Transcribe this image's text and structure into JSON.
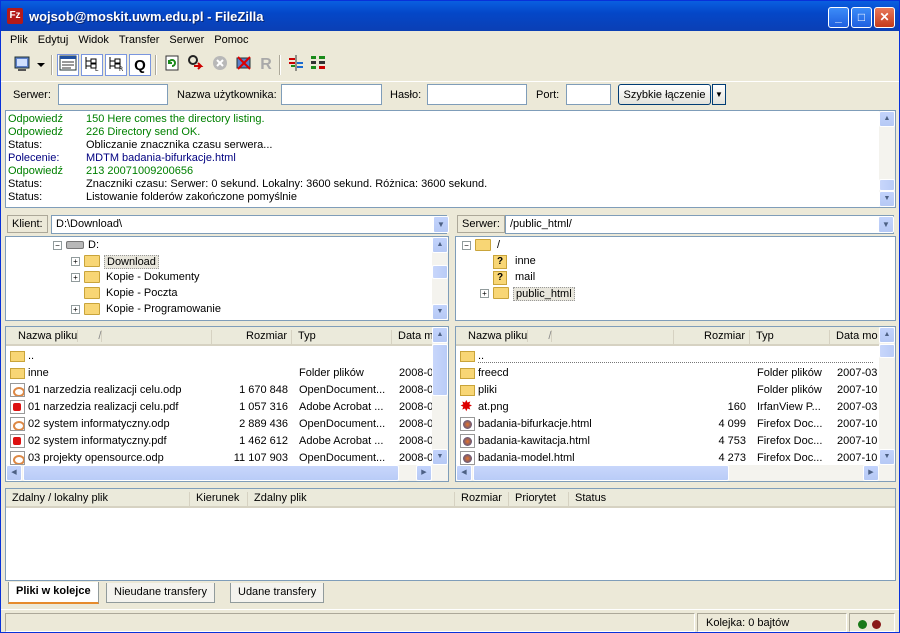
{
  "window": {
    "title": "wojsob@moskit.uwm.edu.pl - FileZilla",
    "app_icon": "Fz",
    "controls": {
      "minimize": "_",
      "maximize": "□",
      "close": "✕"
    }
  },
  "menu": [
    "Plik",
    "Edytuj",
    "Widok",
    "Transfer",
    "Serwer",
    "Pomoc"
  ],
  "toolbar": {
    "icons": [
      "site-manager-icon",
      "toggle-log-icon",
      "toggle-local-tree-icon",
      "toggle-remote-tree-icon",
      "toggle-queue-icon",
      "refresh-icon",
      "process-queue-icon",
      "cancel-icon",
      "disconnect-icon",
      "reconnect-icon",
      "compare-icon",
      "sync-browse-icon"
    ],
    "reconnect_glyph": "R",
    "queue_glyph": "Q"
  },
  "quickconnect": {
    "server_label": "Serwer:",
    "server_value": "",
    "user_label": "Nazwa użytkownika:",
    "user_value": "",
    "password_label": "Hasło:",
    "password_value": "",
    "port_label": "Port:",
    "port_value": "",
    "connect_button": "Szybkie łączenie",
    "dropdown_glyph": "▼"
  },
  "log": [
    {
      "type": "Odpowiedź",
      "msg": "150 Here comes the directory listing.",
      "color": "#008000"
    },
    {
      "type": "Odpowiedź",
      "msg": "226 Directory send OK.",
      "color": "#008000"
    },
    {
      "type": "Status:",
      "msg": "Obliczanie znacznika czasu serwera...",
      "color": "#000000"
    },
    {
      "type": "Polecenie:",
      "msg": "MDTM badania-bifurkacje.html",
      "color": "#000080"
    },
    {
      "type": "Odpowiedź",
      "msg": "213 20071009200656",
      "color": "#008000"
    },
    {
      "type": "Status:",
      "msg": "Znaczniki czasu: Serwer: 0 sekund. Lokalny: 3600 sekund. Różnica: 3600 sekund.",
      "color": "#000000"
    },
    {
      "type": "Status:",
      "msg": "Listowanie folderów zakończone pomyślnie",
      "color": "#000000"
    }
  ],
  "local": {
    "label": "Klient:",
    "path": "D:\\Download\\",
    "tree": [
      {
        "label": "D:",
        "kind": "drive",
        "expander": "−",
        "level": 0
      },
      {
        "label": "Download",
        "kind": "folder",
        "expander": "+",
        "level": 1,
        "selected": true
      },
      {
        "label": "Kopie - Dokumenty",
        "kind": "folder",
        "expander": "+",
        "level": 1
      },
      {
        "label": "Kopie - Poczta",
        "kind": "folder",
        "expander": "",
        "level": 1
      },
      {
        "label": "Kopie - Programowanie",
        "kind": "folder",
        "expander": "+",
        "level": 1
      }
    ],
    "columns": [
      "Nazwa pliku",
      "Rozmiar",
      "Typ",
      "Data m"
    ],
    "sort_glyph": "/",
    "files": [
      {
        "name": "..",
        "size": "",
        "type": "",
        "date": "",
        "icon": "fold"
      },
      {
        "name": "inne",
        "size": "",
        "type": "Folder plików",
        "date": "2008-0",
        "icon": "fold"
      },
      {
        "name": "01 narzedzia realizacji celu.odp",
        "size": "1 670 848",
        "type": "OpenDocument...",
        "date": "2008-0",
        "icon": "odp"
      },
      {
        "name": "01 narzedzia realizacji celu.pdf",
        "size": "1 057 316",
        "type": "Adobe Acrobat ...",
        "date": "2008-0",
        "icon": "pdf"
      },
      {
        "name": "02 system informatyczny.odp",
        "size": "2 889 436",
        "type": "OpenDocument...",
        "date": "2008-0",
        "icon": "odp"
      },
      {
        "name": "02 system informatyczny.pdf",
        "size": "1 462 612",
        "type": "Adobe Acrobat ...",
        "date": "2008-0",
        "icon": "pdf"
      },
      {
        "name": "03 projekty opensource.odp",
        "size": "11 107 903",
        "type": "OpenDocument...",
        "date": "2008-0",
        "icon": "odp"
      }
    ]
  },
  "remote": {
    "label": "Serwer:",
    "path": "/public_html/",
    "tree": [
      {
        "label": "/",
        "kind": "folder",
        "expander": "−",
        "level": 0
      },
      {
        "label": "inne",
        "kind": "unknown",
        "expander": "",
        "level": 1
      },
      {
        "label": "mail",
        "kind": "unknown",
        "expander": "",
        "level": 1
      },
      {
        "label": "public_html",
        "kind": "folder",
        "expander": "+",
        "level": 1,
        "selected": true
      }
    ],
    "unknown_glyph": "?",
    "columns": [
      "Nazwa pliku",
      "Rozmiar",
      "Typ",
      "Data mo"
    ],
    "sort_glyph": "/",
    "files": [
      {
        "name": "..",
        "size": "",
        "type": "",
        "date": "",
        "icon": "fold"
      },
      {
        "name": "freecd",
        "size": "",
        "type": "Folder plików",
        "date": "2007-03",
        "icon": "fold"
      },
      {
        "name": "pliki",
        "size": "",
        "type": "Folder plików",
        "date": "2007-10",
        "icon": "fold"
      },
      {
        "name": "at.png",
        "size": "160",
        "type": "IrfanView P...",
        "date": "2007-03",
        "icon": "png"
      },
      {
        "name": "badania-bifurkacje.html",
        "size": "4 099",
        "type": "Firefox Doc...",
        "date": "2007-10",
        "icon": "html"
      },
      {
        "name": "badania-kawitacja.html",
        "size": "4 753",
        "type": "Firefox Doc...",
        "date": "2007-10",
        "icon": "html"
      },
      {
        "name": "badania-model.html",
        "size": "4 273",
        "type": "Firefox Doc...",
        "date": "2007-10",
        "icon": "html"
      }
    ]
  },
  "queue": {
    "columns": [
      "Zdalny / lokalny plik",
      "Kierunek",
      "Zdalny plik",
      "Rozmiar",
      "Priorytet",
      "Status"
    ]
  },
  "tabs": [
    "Pliki w kolejce",
    "Nieudane transfery",
    "Udane transfery"
  ],
  "status": {
    "queue": "Kolejka: 0 bajtów"
  },
  "colors": {
    "led_green": "#1a7a1a",
    "led_red": "#8a1a1a"
  }
}
